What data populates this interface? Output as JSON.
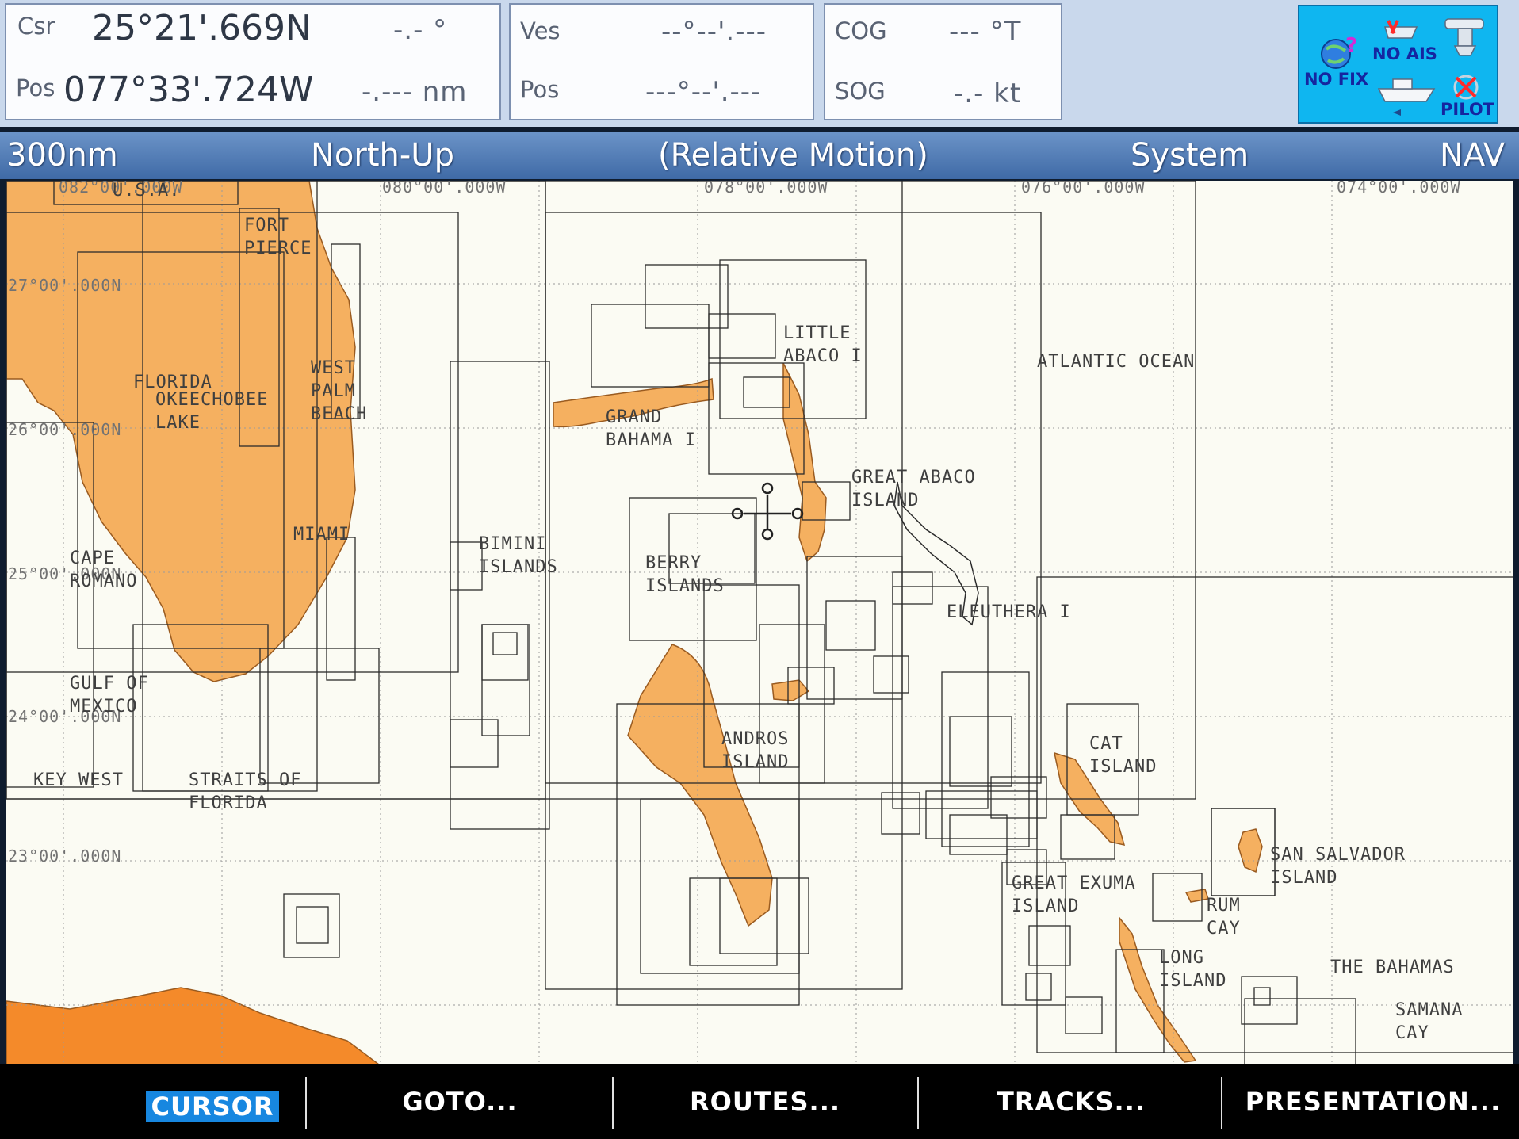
{
  "top_bar": {
    "cursor_box": {
      "csr_label": "Csr",
      "pos_label": "Pos",
      "latitude": "25°21'.669N",
      "longitude": "077°33'.724W",
      "bearing": "-.- °",
      "range": "-.--- nm"
    },
    "vessel_box": {
      "ves_label": "Ves",
      "pos_label": "Pos",
      "latitude": "--°--'.---",
      "longitude": "---°--'.---"
    },
    "cog_sog_box": {
      "cog_label": "COG",
      "cog_value": "--- °T",
      "sog_label": "SOG",
      "sog_value": "-.- kt"
    },
    "status_panel": {
      "no_ais": "NO AIS",
      "no_fix": "NO FIX",
      "pilot": "PILOT"
    }
  },
  "header": {
    "range": "300nm",
    "orientation": "North-Up",
    "motion_mode": "(Relative Motion)",
    "source": "System",
    "mode": "NAV"
  },
  "chart": {
    "longitude_labels": [
      "082°00'.000W",
      "080°00'.000W",
      "078°00'.000W",
      "076°00'.000W",
      "074°00'.000W"
    ],
    "latitude_labels": [
      "27°00'.000N",
      "26°00'.000N",
      "25°00'.000N",
      "24°00'.000N",
      "23°00'.000N"
    ],
    "place_labels": [
      "U.S.A.",
      "FORT\nPIERCE",
      "FLORIDA",
      "OKEECHOBEE\nLAKE",
      "WEST\nPALM\nBEACH",
      "MIAMI",
      "CAPE\nROMANO",
      "GULF OF\nMEXICO",
      "KEY WEST",
      "STRAITS OF\nFLORIDA",
      "BIMINI\nISLANDS",
      "GRAND\nBAHAMA I",
      "LITTLE\nABACO I",
      "GREAT ABACO\nISLAND",
      "ATLANTIC OCEAN",
      "BERRY\nISLANDS",
      "ELEUTHERA I",
      "ANDROS\nISLAND",
      "CAT\nISLAND",
      "SAN SALVADOR\nISLAND",
      "GREAT EXUMA\nISLAND",
      "RUM\nCAY",
      "LONG\nISLAND",
      "THE BAHAMAS",
      "SAMANA\nCAY"
    ],
    "colors": {
      "land": "#f5b060",
      "land_deep": "#f48a2a",
      "sea": "#fbfbf3",
      "chart_lines": "#2b2b2b"
    }
  },
  "softkeys": {
    "cursor": "CURSOR",
    "goto": "GOTO...",
    "routes": "ROUTES...",
    "tracks": "TRACKS...",
    "presentation": "PRESENTATION..."
  }
}
